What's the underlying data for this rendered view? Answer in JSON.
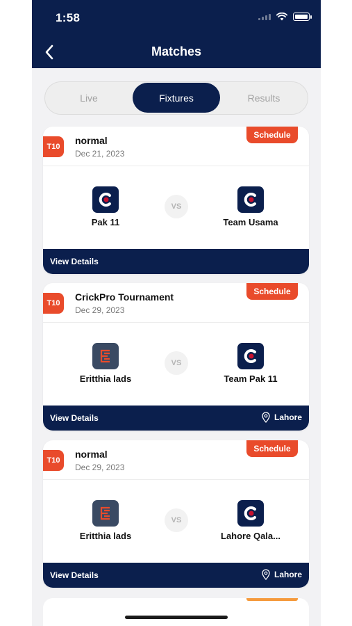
{
  "status_bar": {
    "time": "1:58"
  },
  "header": {
    "title": "Matches"
  },
  "tabs": [
    {
      "label": "Live",
      "active": false
    },
    {
      "label": "Fixtures",
      "active": true
    },
    {
      "label": "Results",
      "active": false
    }
  ],
  "matches": [
    {
      "format": "T10",
      "name": "normal",
      "date": "Dec 21, 2023",
      "status": "Schedule",
      "team1": {
        "name": "Pak 11",
        "logo": "cricket-ball-logo"
      },
      "vs": "VS",
      "team2": {
        "name": "Team Usama",
        "logo": "cricket-ball-logo"
      },
      "action": "View Details",
      "location": ""
    },
    {
      "format": "T10",
      "name": "CrickPro Tournament",
      "date": "Dec 29, 2023",
      "status": "Schedule",
      "team1": {
        "name": "Eritthia lads",
        "logo": "letter-e-logo"
      },
      "vs": "VS",
      "team2": {
        "name": "Team Pak 11",
        "logo": "cricket-ball-logo"
      },
      "action": "View Details",
      "location": "Lahore"
    },
    {
      "format": "T10",
      "name": "normal",
      "date": "Dec 29, 2023",
      "status": "Schedule",
      "team1": {
        "name": "Eritthia lads",
        "logo": "letter-e-logo"
      },
      "vs": "VS",
      "team2": {
        "name": "Lahore Qala...",
        "logo": "cricket-ball-logo"
      },
      "action": "View Details",
      "location": "Lahore"
    }
  ],
  "colors": {
    "navy": "#0b1f4d",
    "accent": "#e94b2b",
    "background": "#f2f2f4"
  }
}
